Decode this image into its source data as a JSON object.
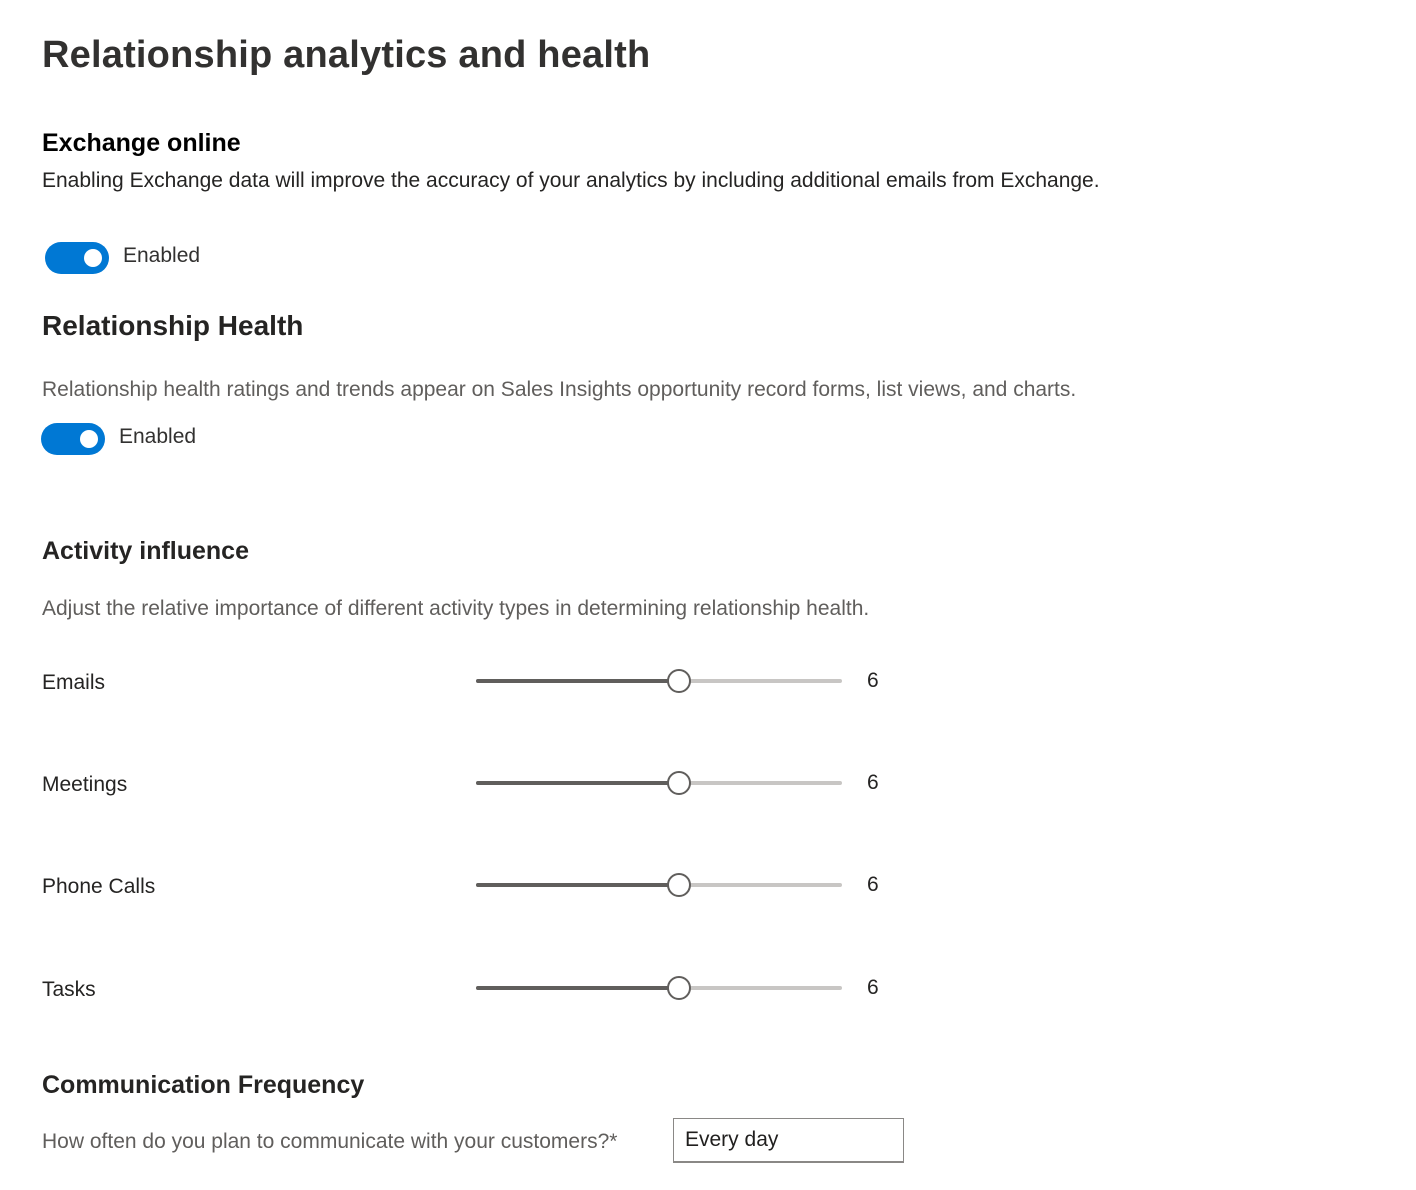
{
  "page": {
    "title": "Relationship analytics and health"
  },
  "exchange": {
    "title": "Exchange online",
    "description": "Enabling Exchange data will improve the accuracy of your analytics by including additional emails from Exchange.",
    "toggle_label": "Enabled",
    "enabled": true
  },
  "health": {
    "title": "Relationship Health",
    "description": "Relationship health ratings and trends appear on Sales Insights opportunity record forms, list views, and charts.",
    "toggle_label": "Enabled",
    "enabled": true
  },
  "activity": {
    "title": "Activity influence",
    "description": "Adjust the relative importance of different activity types in determining relationship health.",
    "slider_min": 1,
    "slider_max": 10,
    "rows": [
      {
        "label": "Emails",
        "value": "6"
      },
      {
        "label": "Meetings",
        "value": "6"
      },
      {
        "label": "Phone Calls",
        "value": "6"
      },
      {
        "label": "Tasks",
        "value": "6"
      }
    ]
  },
  "frequency": {
    "title": "Communication Frequency",
    "question": "How often do you plan to communicate with your customers?*",
    "value": "Every day"
  },
  "colors": {
    "toggle_on": "#0078d4",
    "slider_fill": "#605e5c",
    "slider_rail": "#c8c6c4"
  }
}
